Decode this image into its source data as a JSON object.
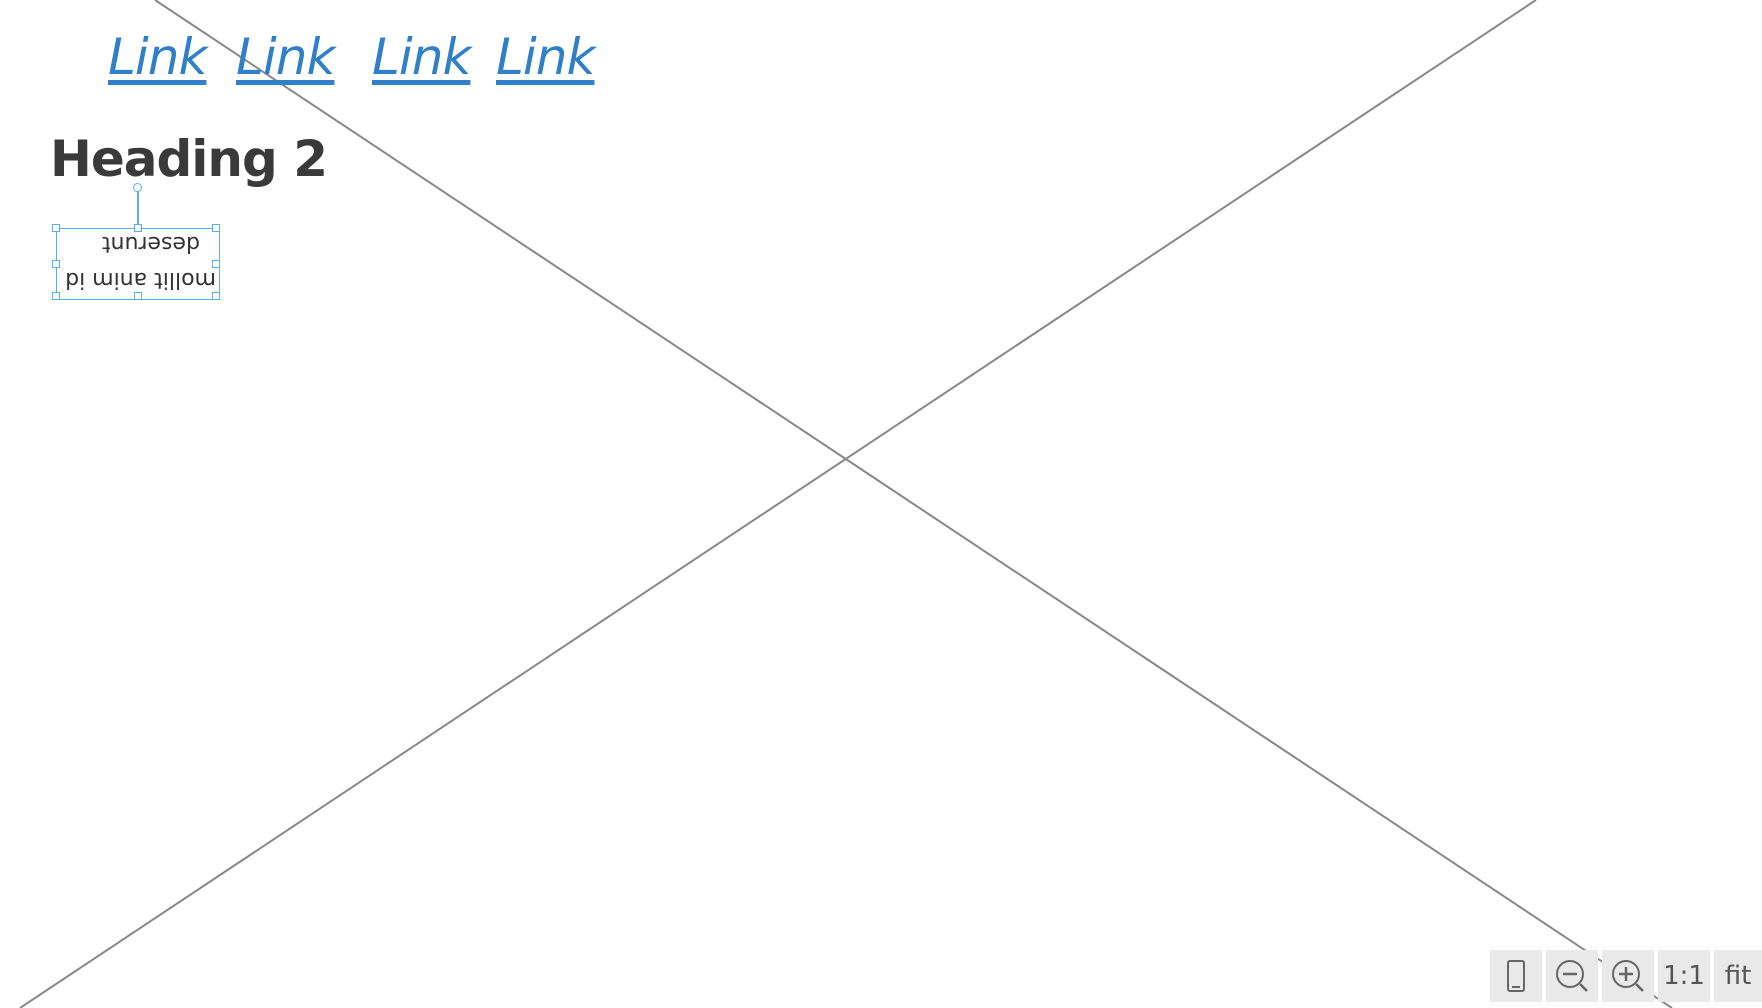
{
  "nav": {
    "links": [
      "Link",
      "Link",
      "Link",
      "Link"
    ]
  },
  "heading": {
    "text": "Heading 2"
  },
  "selected_text": {
    "line1": "mollit anim id",
    "line2": "deserunt"
  },
  "zoom_controls": {
    "device_icon": "phone-outline-icon",
    "zoom_out_icon": "zoom-out-icon",
    "zoom_in_icon": "zoom-in-icon",
    "actual_size_label": "1:1",
    "fit_label": "fit"
  },
  "colors": {
    "link": "#2f80c8",
    "selection": "#5aaee8",
    "placeholder_lines": "#888888"
  }
}
